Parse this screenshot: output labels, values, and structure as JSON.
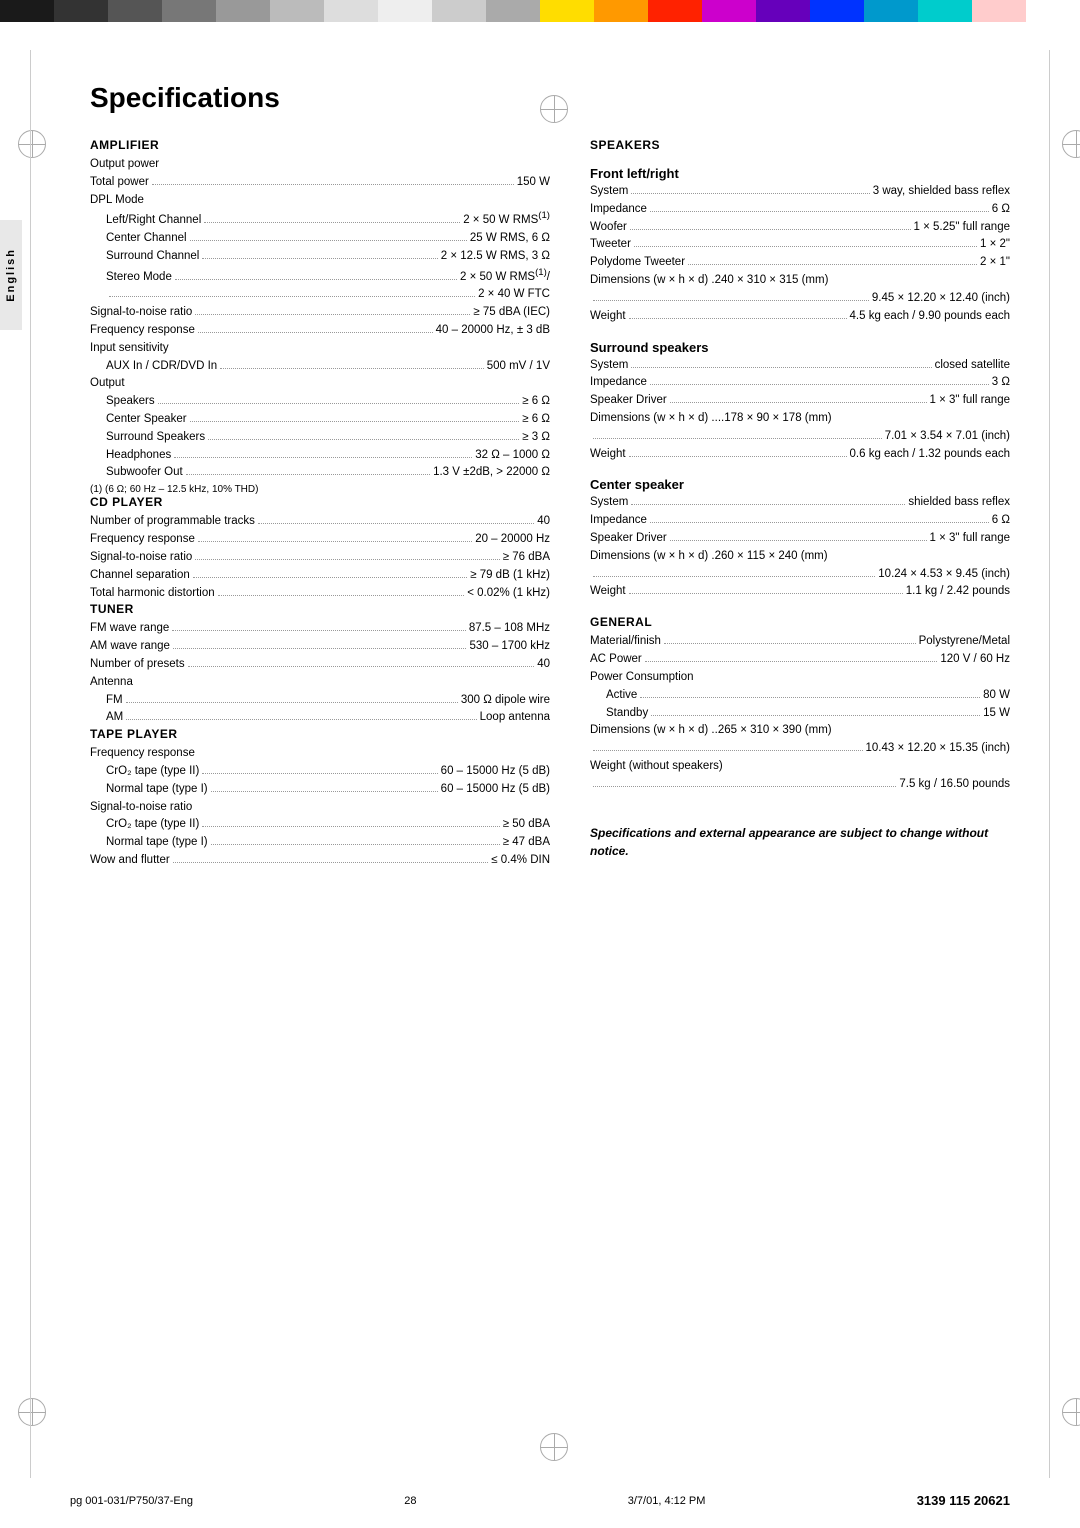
{
  "page": {
    "title": "Specifications",
    "page_number": "28",
    "footer_left": "pg 001-031/P750/37-Eng",
    "footer_middle": "28",
    "footer_date": "3/7/01, 4:12 PM",
    "footer_code": "3139 115 20621",
    "side_tab": "English"
  },
  "top_bar_left": [
    {
      "color": "#222222"
    },
    {
      "color": "#444444"
    },
    {
      "color": "#888888"
    },
    {
      "color": "#aaaaaa"
    },
    {
      "color": "#cccccc"
    },
    {
      "color": "#222222"
    },
    {
      "color": "#444444"
    },
    {
      "color": "#888888"
    },
    {
      "color": "#aaaaaa"
    },
    {
      "color": "#cccccc"
    }
  ],
  "top_bar_right": [
    {
      "color": "#ffdd00"
    },
    {
      "color": "#ff9900"
    },
    {
      "color": "#ff0000"
    },
    {
      "color": "#cc00cc"
    },
    {
      "color": "#6600cc"
    },
    {
      "color": "#0000ff"
    },
    {
      "color": "#0099cc"
    },
    {
      "color": "#00cccc"
    },
    {
      "color": "#cccc00"
    },
    {
      "color": "#ffcccc"
    }
  ],
  "amplifier": {
    "heading": "AMPLIFIER",
    "output_power_label": "Output power",
    "rows": [
      {
        "label": "Total power",
        "dots": true,
        "value": "150 W"
      },
      {
        "label": "DPL Mode",
        "dots": false,
        "value": ""
      },
      {
        "label": "Left/Right Channel",
        "dots": true,
        "value": "2 × 50 W RMS(1)",
        "indent": 1
      },
      {
        "label": "Center Channel",
        "dots": true,
        "value": "25 W RMS, 6 Ω",
        "indent": 1
      },
      {
        "label": "Surround Channel",
        "dots": true,
        "value": "2 × 12.5 W RMS, 3 Ω",
        "indent": 1
      },
      {
        "label": "Stereo Mode",
        "dots": true,
        "value": "2 × 50 W RMS(1)/",
        "indent": 1
      },
      {
        "label": "",
        "dots": true,
        "value": "2 × 40 W FTC",
        "indent": 1
      },
      {
        "label": "Signal-to-noise ratio",
        "dots": true,
        "value": "≥ 75 dBA (IEC)"
      },
      {
        "label": "Frequency response",
        "dots": true,
        "value": "40 – 20000 Hz, ± 3 dB"
      },
      {
        "label": "Input sensitivity",
        "dots": false,
        "value": ""
      },
      {
        "label": "AUX In / CDR/DVD In",
        "dots": true,
        "value": "500 mV / 1V",
        "indent": 1
      },
      {
        "label": "Output",
        "dots": false,
        "value": ""
      },
      {
        "label": "Speakers",
        "dots": true,
        "value": "≥ 6 Ω",
        "indent": 1
      },
      {
        "label": "Center Speaker",
        "dots": true,
        "value": "≥ 6 Ω",
        "indent": 1
      },
      {
        "label": "Surround Speakers",
        "dots": true,
        "value": "≥ 3 Ω",
        "indent": 1
      },
      {
        "label": "Headphones",
        "dots": true,
        "value": "32 Ω – 1000 Ω",
        "indent": 1
      },
      {
        "label": "Subwoofer Out",
        "dots": true,
        "value": "1.3 V ±2dB, > 22000 Ω",
        "indent": 1
      }
    ],
    "footnote": "(1) (6 Ω; 60 Hz – 12.5 kHz, 10% THD)"
  },
  "cd_player": {
    "heading": "CD PLAYER",
    "rows": [
      {
        "label": "Number of programmable tracks",
        "dots": true,
        "value": "40"
      },
      {
        "label": "Frequency response",
        "dots": true,
        "value": "20 – 20000 Hz"
      },
      {
        "label": "Signal-to-noise ratio",
        "dots": true,
        "value": "≥ 76 dBA"
      },
      {
        "label": "Channel separation",
        "dots": true,
        "value": "≥ 79 dB (1 kHz)"
      },
      {
        "label": "Total harmonic distortion",
        "dots": true,
        "value": "< 0.02% (1 kHz)"
      }
    ]
  },
  "tuner": {
    "heading": "TUNER",
    "rows": [
      {
        "label": "FM wave range",
        "dots": true,
        "value": "87.5 – 108 MHz"
      },
      {
        "label": "AM wave range",
        "dots": true,
        "value": "530 – 1700 kHz"
      },
      {
        "label": "Number of presets",
        "dots": true,
        "value": "40"
      },
      {
        "label": "Antenna",
        "dots": false,
        "value": ""
      },
      {
        "label": "FM",
        "dots": true,
        "value": "300 Ω dipole wire",
        "indent": 1
      },
      {
        "label": "AM",
        "dots": true,
        "value": "Loop antenna",
        "indent": 1
      }
    ]
  },
  "tape_player": {
    "heading": "TAPE PLAYER",
    "freq_label": "Frequency response",
    "rows_freq": [
      {
        "label": "CrO₂ tape (type II)",
        "dots": true,
        "value": "60 – 15000 Hz (5 dB)",
        "indent": 1
      },
      {
        "label": "Normal tape (type I)",
        "dots": true,
        "value": "60 – 15000 Hz (5 dB)",
        "indent": 1
      }
    ],
    "snr_label": "Signal-to-noise ratio",
    "rows_snr": [
      {
        "label": "CrO₂ tape (type II)",
        "dots": true,
        "value": "≥ 50 dBA",
        "indent": 1
      },
      {
        "label": "Normal tape (type I)",
        "dots": true,
        "value": "≥ 47 dBA",
        "indent": 1
      }
    ],
    "rows_other": [
      {
        "label": "Wow and flutter",
        "dots": true,
        "value": "≤ 0.4% DIN"
      }
    ]
  },
  "speakers": {
    "heading": "SPEAKERS",
    "front_subheading": "Front left/right",
    "front_rows": [
      {
        "label": "System",
        "dots": true,
        "value": "3 way, shielded bass reflex"
      },
      {
        "label": "Impedance",
        "dots": true,
        "value": "6 Ω"
      },
      {
        "label": "Woofer",
        "dots": true,
        "value": "1 × 5.25\" full range"
      },
      {
        "label": "Tweeter",
        "dots": true,
        "value": "1 × 2\""
      },
      {
        "label": "Polydome Tweeter",
        "dots": true,
        "value": "2 × 1\""
      },
      {
        "label": "Dimensions (w × h × d)",
        "dots": false,
        "value": ".240 × 310 × 315 (mm)"
      },
      {
        "label": "",
        "dots": true,
        "value": "9.45 × 12.20 × 12.40 (inch)"
      },
      {
        "label": "Weight",
        "dots": true,
        "value": "4.5 kg each / 9.90 pounds each"
      }
    ],
    "surround_subheading": "Surround speakers",
    "surround_rows": [
      {
        "label": "System",
        "dots": true,
        "value": "closed satellite"
      },
      {
        "label": "Impedance",
        "dots": true,
        "value": "3 Ω"
      },
      {
        "label": "Speaker Driver",
        "dots": true,
        "value": "1 × 3\" full range"
      },
      {
        "label": "Dimensions (w × h × d)",
        "dots": false,
        "value": "....178 × 90 × 178 (mm)"
      },
      {
        "label": "",
        "dots": true,
        "value": "7.01 × 3.54 × 7.01 (inch)"
      },
      {
        "label": "Weight",
        "dots": true,
        "value": "0.6 kg each / 1.32 pounds each"
      }
    ],
    "center_subheading": "Center speaker",
    "center_rows": [
      {
        "label": "System",
        "dots": true,
        "value": "shielded bass reflex"
      },
      {
        "label": "Impedance",
        "dots": true,
        "value": "6 Ω"
      },
      {
        "label": "Speaker Driver",
        "dots": true,
        "value": "1 × 3\" full range"
      },
      {
        "label": "Dimensions (w × h × d)",
        "dots": false,
        "value": ".260 × 115 × 240 (mm)"
      },
      {
        "label": "",
        "dots": true,
        "value": "10.24 × 4.53 × 9.45 (inch)"
      },
      {
        "label": "Weight",
        "dots": true,
        "value": "1.1 kg / 2.42 pounds"
      }
    ]
  },
  "general": {
    "heading": "GENERAL",
    "rows": [
      {
        "label": "Material/finish",
        "dots": true,
        "value": "Polystyrene/Metal"
      },
      {
        "label": "AC Power",
        "dots": true,
        "value": "120 V / 60 Hz"
      },
      {
        "label": "Power Consumption",
        "dots": false,
        "value": ""
      },
      {
        "label": "Active",
        "dots": true,
        "value": "80 W",
        "indent": 1
      },
      {
        "label": "Standby",
        "dots": true,
        "value": "15 W",
        "indent": 1
      },
      {
        "label": "Dimensions (w × h × d)",
        "dots": false,
        "value": "..265 × 310 × 390 (mm)"
      },
      {
        "label": "",
        "dots": true,
        "value": "10.43 × 12.20 × 15.35 (inch)"
      },
      {
        "label": "Weight (without speakers)",
        "dots": false,
        "value": ""
      },
      {
        "label": "",
        "dots": true,
        "value": "7.5 kg / 16.50 pounds"
      }
    ]
  },
  "notice": {
    "text": "Specifications and external appearance are subject to change without notice."
  }
}
